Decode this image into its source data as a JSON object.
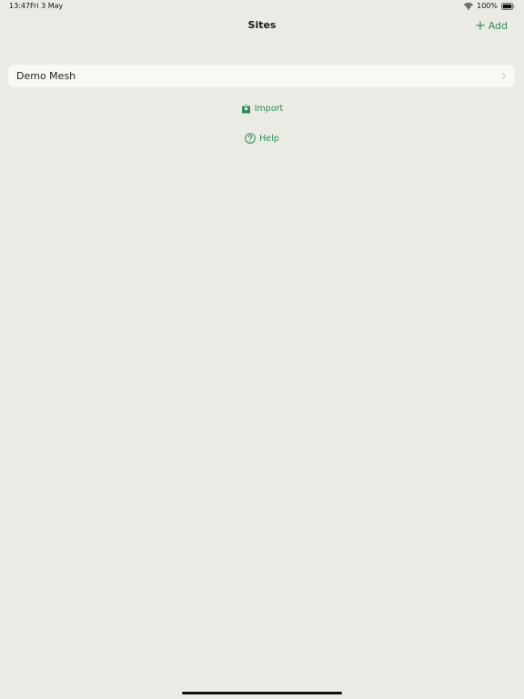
{
  "status_bar": {
    "time": "13:47",
    "date": "Fri 3 May",
    "battery": "100%",
    "icons": [
      "wifi-icon",
      "battery-icon"
    ]
  },
  "nav": {
    "title": "Sites",
    "add_label": "Add",
    "add_icon": "plus-icon"
  },
  "sites": [
    {
      "name": "Demo Mesh",
      "icon": "chevron-right-icon"
    }
  ],
  "actions": {
    "import_label": "Import",
    "import_icon": "import-icon",
    "help_label": "Help",
    "help_icon": "help-icon"
  },
  "colors": {
    "background": "#ebebe6",
    "card": "#f8f8f4",
    "accent": "#2e8b57"
  }
}
